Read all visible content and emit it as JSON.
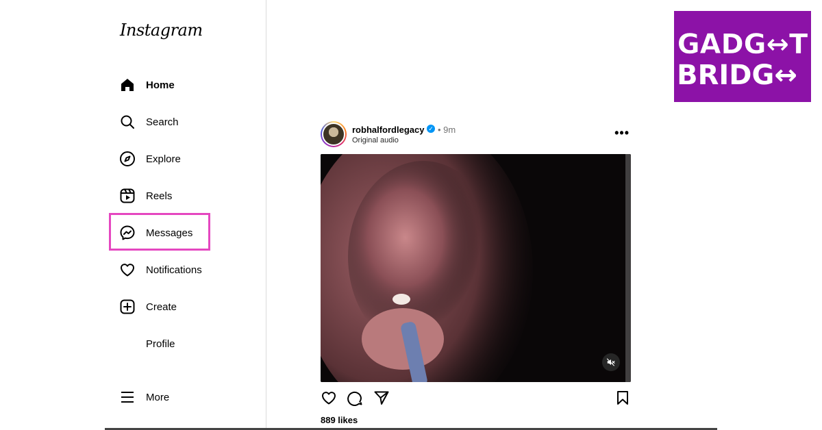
{
  "app": {
    "logo": "Instagram"
  },
  "sidebar": {
    "items": [
      {
        "label": "Home",
        "icon": "home-icon"
      },
      {
        "label": "Search",
        "icon": "search-icon"
      },
      {
        "label": "Explore",
        "icon": "compass-icon"
      },
      {
        "label": "Reels",
        "icon": "reels-icon"
      },
      {
        "label": "Messages",
        "icon": "messenger-icon"
      },
      {
        "label": "Notifications",
        "icon": "heart-icon"
      },
      {
        "label": "Create",
        "icon": "plus-square-icon"
      },
      {
        "label": "Profile",
        "icon": ""
      },
      {
        "label": "More",
        "icon": "menu-icon"
      }
    ],
    "active": "Home",
    "highlighted": "Messages",
    "highlight_color": "#e547c0"
  },
  "post": {
    "username": "robhalfordlegacy",
    "verified": true,
    "time": "9m",
    "audio": "Original audio",
    "likes": "889 likes",
    "media_state": "muted"
  },
  "watermark": {
    "line1": "GADG↔T",
    "line2": "BRIDG↔",
    "background": "#8c12a7"
  }
}
